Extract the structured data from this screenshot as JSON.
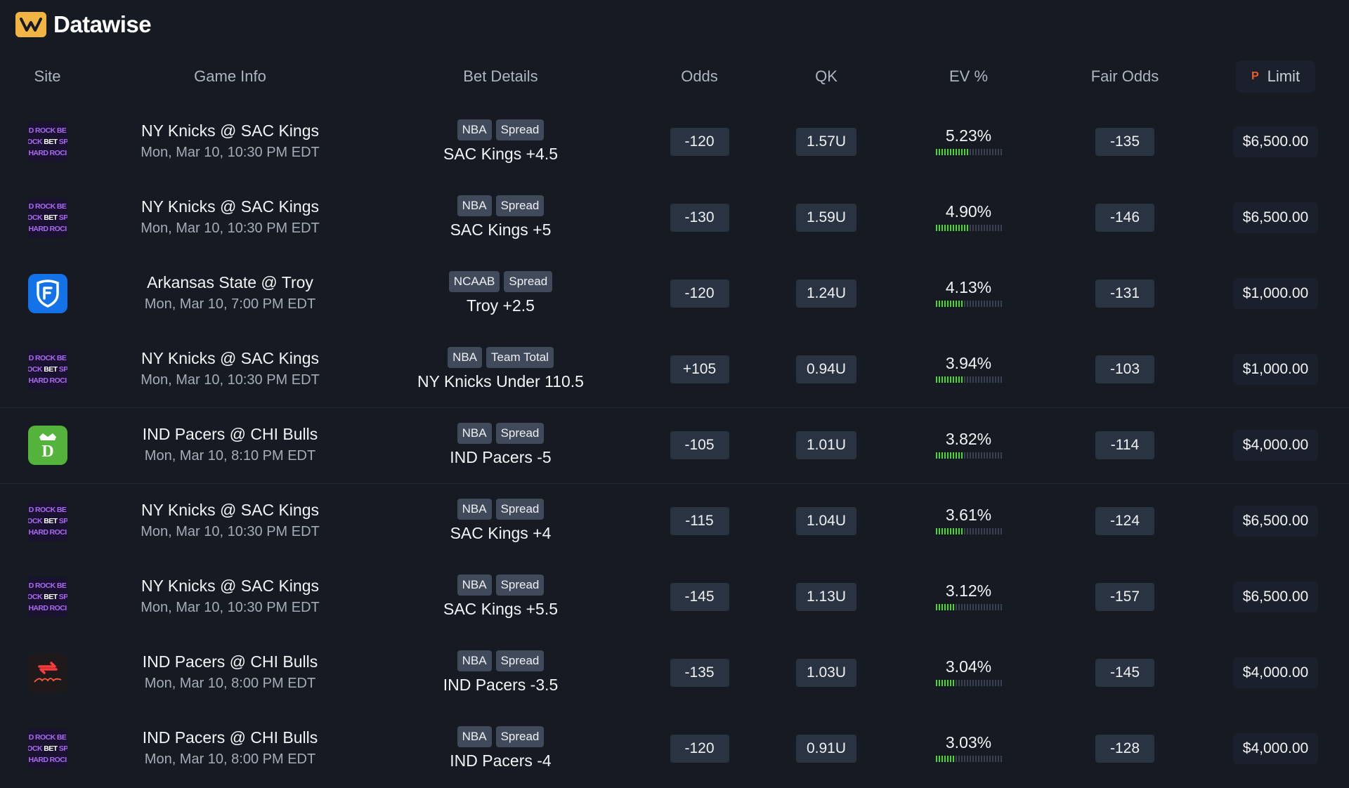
{
  "app": {
    "brand": "Datawise"
  },
  "columns": {
    "site": "Site",
    "game_info": "Game Info",
    "bet_details": "Bet Details",
    "odds": "Odds",
    "qk": "QK",
    "ev": "EV %",
    "fair_odds": "Fair Odds",
    "limit": "Limit"
  },
  "colors": {
    "background": "#151a23",
    "pill": "#2a3342",
    "ev_bar_on": "#4fd63a",
    "ev_bar_off": "#3a4252",
    "brand_logo": "#f2b544"
  },
  "rows": [
    {
      "site_icon": "hard-rock-bet-logo",
      "game": "NY Knicks @ SAC Kings",
      "time": "Mon, Mar 10, 10:30 PM EDT",
      "league": "NBA",
      "market": "Spread",
      "bet": "SAC Kings +4.5",
      "odds": "-120",
      "qk": "1.57U",
      "ev": "5.23%",
      "ev_fill": 0.5,
      "fair_odds": "-135",
      "limit": "$6,500.00"
    },
    {
      "site_icon": "hard-rock-bet-logo",
      "game": "NY Knicks @ SAC Kings",
      "time": "Mon, Mar 10, 10:30 PM EDT",
      "league": "NBA",
      "market": "Spread",
      "bet": "SAC Kings +5",
      "odds": "-130",
      "qk": "1.59U",
      "ev": "4.90%",
      "ev_fill": 0.5,
      "fair_odds": "-146",
      "limit": "$6,500.00"
    },
    {
      "site_icon": "fanduel-logo",
      "game": "Arkansas State @ Troy",
      "time": "Mon, Mar 10, 7:00 PM EDT",
      "league": "NCAAB",
      "market": "Spread",
      "bet": "Troy +2.5",
      "odds": "-120",
      "qk": "1.24U",
      "ev": "4.13%",
      "ev_fill": 0.4,
      "fair_odds": "-131",
      "limit": "$1,000.00"
    },
    {
      "site_icon": "hard-rock-bet-logo",
      "game": "NY Knicks @ SAC Kings",
      "time": "Mon, Mar 10, 10:30 PM EDT",
      "league": "NBA",
      "market": "Team Total",
      "bet": "NY Knicks Under 110.5",
      "odds": "+105",
      "qk": "0.94U",
      "ev": "3.94%",
      "ev_fill": 0.4,
      "fair_odds": "-103",
      "limit": "$1,000.00"
    },
    {
      "site_icon": "draftkings-logo",
      "game": "IND Pacers @ CHI Bulls",
      "time": "Mon, Mar 10, 8:10 PM EDT",
      "league": "NBA",
      "market": "Spread",
      "bet": "IND Pacers -5",
      "odds": "-105",
      "qk": "1.01U",
      "ev": "3.82%",
      "ev_fill": 0.4,
      "fair_odds": "-114",
      "limit": "$4,000.00"
    },
    {
      "site_icon": "hard-rock-bet-logo",
      "game": "NY Knicks @ SAC Kings",
      "time": "Mon, Mar 10, 10:30 PM EDT",
      "league": "NBA",
      "market": "Spread",
      "bet": "SAC Kings +4",
      "odds": "-115",
      "qk": "1.04U",
      "ev": "3.61%",
      "ev_fill": 0.4,
      "fair_odds": "-124",
      "limit": "$6,500.00"
    },
    {
      "site_icon": "hard-rock-bet-logo",
      "game": "NY Knicks @ SAC Kings",
      "time": "Mon, Mar 10, 10:30 PM EDT",
      "league": "NBA",
      "market": "Spread",
      "bet": "SAC Kings +5.5",
      "odds": "-145",
      "qk": "1.13U",
      "ev": "3.12%",
      "ev_fill": 0.3,
      "fair_odds": "-157",
      "limit": "$6,500.00"
    },
    {
      "site_icon": "rebet-logo",
      "game": "IND Pacers @ CHI Bulls",
      "time": "Mon, Mar 10, 8:00 PM EDT",
      "league": "NBA",
      "market": "Spread",
      "bet": "IND Pacers -3.5",
      "odds": "-135",
      "qk": "1.03U",
      "ev": "3.04%",
      "ev_fill": 0.3,
      "fair_odds": "-145",
      "limit": "$4,000.00"
    },
    {
      "site_icon": "hard-rock-bet-logo",
      "game": "IND Pacers @ CHI Bulls",
      "time": "Mon, Mar 10, 8:00 PM EDT",
      "league": "NBA",
      "market": "Spread",
      "bet": "IND Pacers -4",
      "odds": "-120",
      "qk": "0.91U",
      "ev": "3.03%",
      "ev_fill": 0.3,
      "fair_odds": "-128",
      "limit": "$4,000.00"
    }
  ]
}
